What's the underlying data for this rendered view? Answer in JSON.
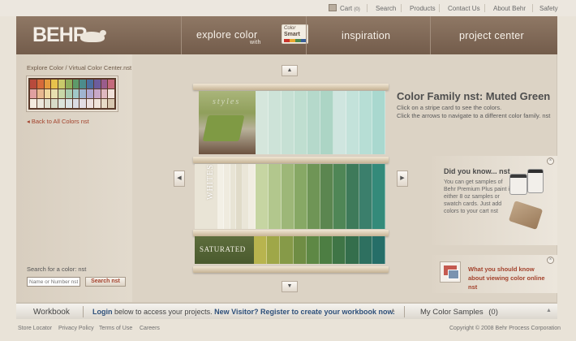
{
  "topbar": {
    "cart_label": "Cart",
    "cart_count": "(0)",
    "links": [
      "Search",
      "Products",
      "Contact Us",
      "About Behr",
      "Safety"
    ]
  },
  "header": {
    "logo": "BEHR",
    "nav": {
      "explore": "explore color",
      "with": "with",
      "colorsmart_1": "Color",
      "colorsmart_2": "Smart",
      "inspiration": "inspiration",
      "project_center": "project center"
    }
  },
  "left": {
    "breadcrumb": "Explore Color / Virtual Color Center.nst",
    "back_link": "◂ Back to All Colors nst",
    "search_label": "Search for a color: nst",
    "search_placeholder": "Name or Number nst",
    "search_button": "Search nst",
    "thumb_colors": [
      "#b84a3c",
      "#d66a3a",
      "#e59a3e",
      "#e8c24c",
      "#c9c96a",
      "#8fae5c",
      "#5e9a6a",
      "#4c8c8c",
      "#4c6fa0",
      "#6c5c9c",
      "#9a5c8c",
      "#c46a7c",
      "#e0a0a0",
      "#e8b890",
      "#f0d8a0",
      "#e8e0b0",
      "#c8d8a8",
      "#a8ccb0",
      "#a0c8c8",
      "#a0b4d0",
      "#b0a8d0",
      "#c8a8c8",
      "#e0b8c0",
      "#f0e0d8",
      "#f4ece0",
      "#ece8dc",
      "#e0e0d0",
      "#d8dcc8",
      "#dce4dc",
      "#dae2e4",
      "#dadce4",
      "#e2dce4",
      "#ece0e0",
      "#f0e4dc",
      "#e8dcc8",
      "#d8c8b0"
    ]
  },
  "palette": {
    "row1_colors": [
      "#d5e6dc",
      "#cde3d8",
      "#c6e0d4",
      "#bfded0",
      "#b5d9cb",
      "#acd5c5",
      "#cfe5df",
      "#c3e2da",
      "#b7ded5",
      "#a9d8cf"
    ],
    "row1_word": "styles",
    "row2_whites": [
      "#f3f0e6",
      "#efebdf",
      "#e8e4d5",
      "#e0dbc9",
      "#eae6d8",
      "#f1ede2"
    ],
    "row2_colors": [
      "#c6d5a2",
      "#b2c78d",
      "#9db778",
      "#87a865",
      "#6f9556",
      "#5b8650",
      "#4f8656",
      "#3e7a5a",
      "#3b7f6c",
      "#348a7a"
    ],
    "row2_label": "WHITES",
    "row3_colors": [
      "#b8b44e",
      "#9fa748",
      "#869a48",
      "#6f8d44",
      "#5e8845",
      "#4d7e43",
      "#3f7546",
      "#346e4c",
      "#2e7060",
      "#266e68"
    ],
    "row3_label": "SATURATED"
  },
  "info": {
    "title": "Color Family nst: Muted Green",
    "line1": "Click on a stripe card to see the colors.",
    "line2": "Click the arrows to navigate to a different color family. nst"
  },
  "did_you_know": {
    "title": "Did you know... nst",
    "lines": [
      "You can get samples of",
      "Behr Premium Plus paint in",
      "either 8 oz samples or",
      "swatch cards. Just add",
      "colors to your cart nst"
    ]
  },
  "tip": {
    "line1": "What you should know",
    "line2": "about viewing color online",
    "line3": "nst"
  },
  "workbook": {
    "label": "Workbook",
    "login": "Login",
    "login_rest": "below to access your projects.",
    "register": "New Visitor? Register to create your workbook now.",
    "samples": "My Color Samples",
    "samples_count": "(0)"
  },
  "footer": {
    "links": [
      "Store Locator",
      "Privacy Policy",
      "Terms of Use",
      "Careers"
    ],
    "copyright": "Copyright © 2008 Behr Process Corporation"
  }
}
